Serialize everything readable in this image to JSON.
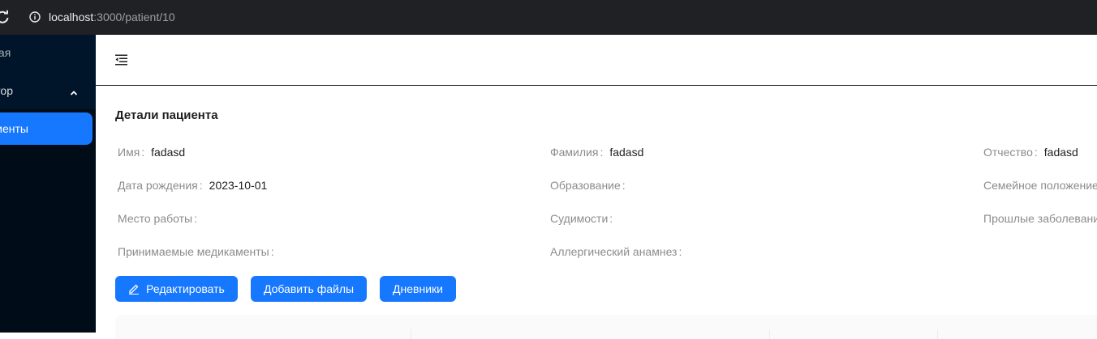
{
  "browser": {
    "url_host": "localhost",
    "url_path": ":3000/patient/10"
  },
  "sidebar": {
    "home_label": "Главная",
    "group_label": "Доктор",
    "patients_label": "Пациенты"
  },
  "page": {
    "title": "Детали пациента"
  },
  "fields": [
    {
      "label": "Имя",
      "value": "fadasd"
    },
    {
      "label": "Фамилия",
      "value": "fadasd"
    },
    {
      "label": "Отчество",
      "value": "fadasd"
    },
    {
      "label": "Дата рождения",
      "value": "2023-10-01"
    },
    {
      "label": "Образование",
      "value": ""
    },
    {
      "label": "Семейное положение",
      "value": ""
    },
    {
      "label": "Место работы",
      "value": ""
    },
    {
      "label": "Судимости",
      "value": ""
    },
    {
      "label": "Прошлые заболевания",
      "value": ""
    },
    {
      "label": "Принимаемые медикаменты",
      "value": ""
    },
    {
      "label": "Аллергический анамнез",
      "value": ""
    }
  ],
  "actions": {
    "edit_label": "Редактировать",
    "add_files_label": "Добавить файлы",
    "diaries_label": "Дневники"
  },
  "colors": {
    "primary": "#1677ff",
    "sidebar_bg": "#001529",
    "browser_bg": "#202124"
  }
}
